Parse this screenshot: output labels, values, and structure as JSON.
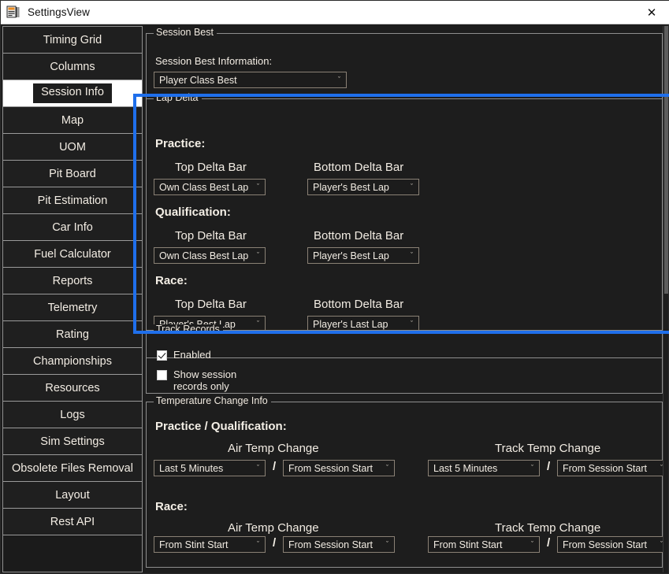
{
  "window": {
    "title": "SettingsView",
    "icon": "app-icon",
    "close_label": "✕"
  },
  "sidebar": {
    "items": [
      {
        "label": "Timing Grid",
        "selected": false
      },
      {
        "label": "Columns",
        "selected": false
      },
      {
        "label": "Session Info",
        "selected": true
      },
      {
        "label": "Map",
        "selected": false
      },
      {
        "label": "UOM",
        "selected": false
      },
      {
        "label": "Pit Board",
        "selected": false
      },
      {
        "label": "Pit Estimation",
        "selected": false
      },
      {
        "label": "Car Info",
        "selected": false
      },
      {
        "label": "Fuel Calculator",
        "selected": false
      },
      {
        "label": "Reports",
        "selected": false
      },
      {
        "label": "Telemetry",
        "selected": false
      },
      {
        "label": "Rating",
        "selected": false
      },
      {
        "label": "Championships",
        "selected": false
      },
      {
        "label": "Resources",
        "selected": false
      },
      {
        "label": "Logs",
        "selected": false
      },
      {
        "label": "Sim Settings",
        "selected": false
      },
      {
        "label": "Obsolete Files Removal",
        "selected": false
      },
      {
        "label": "Layout",
        "selected": false
      },
      {
        "label": "Rest API",
        "selected": false
      }
    ]
  },
  "session_best": {
    "legend": "Session Best",
    "field_label": "Session Best Information:",
    "value": "Player Class Best"
  },
  "lap_delta": {
    "legend": "Lap Delta",
    "highlighted": true,
    "highlight_color": "#1f6feb",
    "sections": [
      {
        "title": "Practice:",
        "top_label": "Top Delta Bar",
        "top_value": "Own Class Best Lap",
        "bottom_label": "Bottom Delta Bar",
        "bottom_value": "Player's Best Lap"
      },
      {
        "title": "Qualification:",
        "top_label": "Top Delta Bar",
        "top_value": "Own Class Best Lap",
        "bottom_label": "Bottom Delta Bar",
        "bottom_value": "Player's Best Lap"
      },
      {
        "title": "Race:",
        "top_label": "Top Delta Bar",
        "top_value": "Player's Best Lap",
        "bottom_label": "Bottom Delta Bar",
        "bottom_value": "Player's Last Lap"
      }
    ]
  },
  "track_records": {
    "legend": "Track Records",
    "enabled_label": "Enabled",
    "enabled_checked": true,
    "session_only_label": "Show session\nrecords only",
    "session_only_checked": false
  },
  "temperature": {
    "legend": "Temperature Change Info",
    "groups": [
      {
        "title": "Practice / Qualification:",
        "air_label": "Air Temp Change",
        "air_first": "Last 5 Minutes",
        "air_separator": "/",
        "air_second": "From Session Start",
        "track_label": "Track Temp Change",
        "track_first": "Last 5 Minutes",
        "track_separator": "/",
        "track_second": "From Session Start"
      },
      {
        "title": "Race:",
        "air_label": "Air Temp Change",
        "air_first": "From Stint Start",
        "air_separator": "/",
        "air_second": "From Session Start",
        "track_label": "Track Temp Change",
        "track_first": "From Stint Start",
        "track_separator": "/",
        "track_second": "From Session Start"
      }
    ]
  },
  "icons": {
    "chevron_down": "ˇ"
  }
}
